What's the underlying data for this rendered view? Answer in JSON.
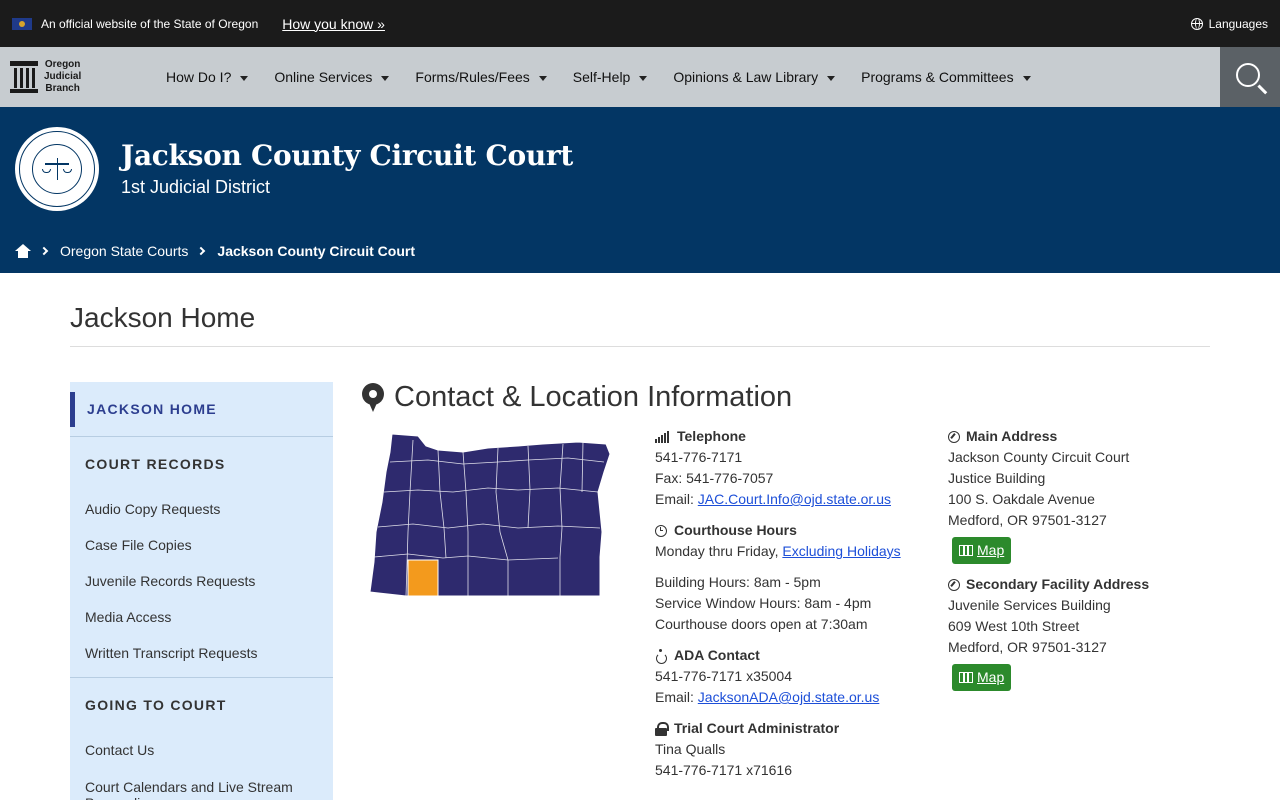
{
  "gov_banner": {
    "text": "An official website of the State of Oregon",
    "how_you_know": "How you know »",
    "languages": "Languages"
  },
  "nav": {
    "logo_lines": [
      "Oregon",
      "Judicial",
      "Branch"
    ],
    "items": [
      "How Do I?",
      "Online Services",
      "Forms/Rules/Fees",
      "Self-Help",
      "Opinions & Law Library",
      "Programs & Committees"
    ]
  },
  "header": {
    "title": "Jackson County Circuit Court",
    "subtitle": "1st Judicial District",
    "breadcrumb": [
      "Oregon State Courts",
      "Jackson County Circuit Court"
    ]
  },
  "page": {
    "title": "Jackson Home"
  },
  "sidebar": {
    "home": "JACKSON HOME",
    "sections": [
      {
        "heading": "COURT RECORDS",
        "links": [
          "Audio Copy Requests",
          "Case File Copies",
          "Juvenile Records Requests",
          "Media Access",
          "Written Transcript Requests"
        ]
      },
      {
        "heading": "GOING TO COURT",
        "links": [
          "Contact Us",
          "Court Calendars and Live Stream Proceedings"
        ]
      }
    ]
  },
  "contact": {
    "title": "Contact & Location Information",
    "telephone": {
      "heading": "Telephone",
      "phone": "541-776-7171",
      "fax": "Fax:  541-776-7057",
      "email_label": "Email: ",
      "email": "JAC.Court.Info@ojd.state.or.us"
    },
    "hours": {
      "heading": "Courthouse Hours",
      "days": "Monday thru Friday, ",
      "holidays_link": "Excluding Holidays",
      "building": "Building Hours: 8am - 5pm",
      "service": "Service Window Hours: 8am - 4pm",
      "doors": "Courthouse doors open at 7:30am"
    },
    "ada": {
      "heading": "ADA Contact",
      "phone": "541-776-7171 x35004",
      "email_label": "Email: ",
      "email": "JacksonADA@ojd.state.or.us"
    },
    "admin": {
      "heading": "Trial Court Administrator",
      "name": "Tina Qualls",
      "phone": "541-776-7171 x71616"
    },
    "main_address": {
      "heading": "Main Address",
      "lines": [
        "Jackson County Circuit Court",
        "Justice Building",
        "100 S. Oakdale Avenue",
        "Medford, OR 97501-3127"
      ],
      "map_label": "Map"
    },
    "secondary_address": {
      "heading": "Secondary Facility Address",
      "lines": [
        "Juvenile Services Building",
        "609 West 10th Street",
        "Medford, OR 97501-3127"
      ],
      "map_label": "Map"
    }
  },
  "colors": {
    "map_fill": "#2e2a6e",
    "map_highlight": "#f39a1d",
    "header_bg": "#033664",
    "sidebar_bg": "#dbebfb",
    "map_button": "#2c8a2c"
  }
}
